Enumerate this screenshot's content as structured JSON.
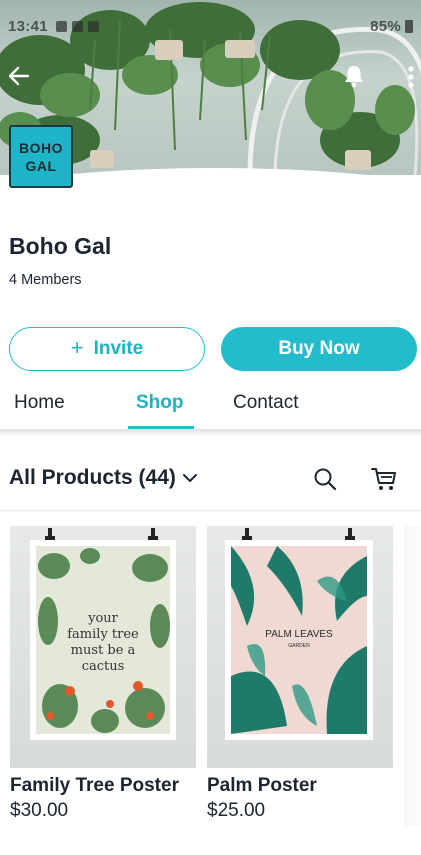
{
  "status_bar": {
    "time": "13:41",
    "battery": "85%"
  },
  "group": {
    "logo_line1": "BOHO",
    "logo_line2": "GAL",
    "name": "Boho Gal",
    "members": "4 Members"
  },
  "actions": {
    "invite_label": "Invite",
    "buy_label": "Buy Now"
  },
  "tabs": [
    {
      "label": "Home",
      "active": false
    },
    {
      "label": "Shop",
      "active": true
    },
    {
      "label": "Contact",
      "active": false
    }
  ],
  "products_header": {
    "title": "All Products (44)"
  },
  "products": [
    {
      "name": "Family Tree Poster",
      "price": "$30.00",
      "poster_lines": [
        "your",
        "family tree",
        "must be a",
        "cactus"
      ]
    },
    {
      "name": "Palm Poster",
      "price": "$25.00",
      "poster_title": "PALM LEAVES",
      "poster_subtitle": "GARDEN"
    }
  ],
  "colors": {
    "accent": "#23bccd",
    "text": "#1c2530",
    "logo_bg": "#1fb5c8"
  },
  "icons": [
    "back-arrow-icon",
    "bell-icon",
    "more-vertical-icon",
    "plus-icon",
    "chevron-down-icon",
    "search-icon",
    "cart-icon"
  ]
}
